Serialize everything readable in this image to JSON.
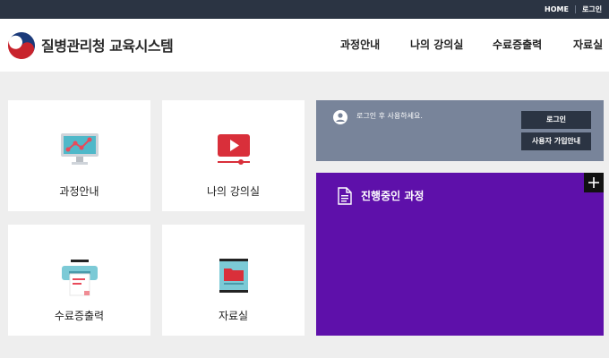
{
  "topbar": {
    "home": "HOME",
    "login": "로그인"
  },
  "header": {
    "logo_text": "질병관리청 교육시스템"
  },
  "nav": [
    {
      "label": "과정안내"
    },
    {
      "label": "나의 강의실"
    },
    {
      "label": "수료증출력"
    },
    {
      "label": "자료실"
    }
  ],
  "tiles": [
    {
      "label": "과정안내"
    },
    {
      "label": "나의 강의실"
    },
    {
      "label": "수료증출력"
    },
    {
      "label": "자료실"
    }
  ],
  "login_box": {
    "message": "로그인 후 사용하세요.",
    "login_button": "로그인",
    "signup_button": "사용자 가입안내"
  },
  "course_box": {
    "title": "진행중인 과정",
    "plus": "+"
  },
  "colors": {
    "topbar": "#2b3443",
    "login_panel": "#78849a",
    "course_panel": "#5e10aa",
    "accent_red": "#d92f3a"
  }
}
